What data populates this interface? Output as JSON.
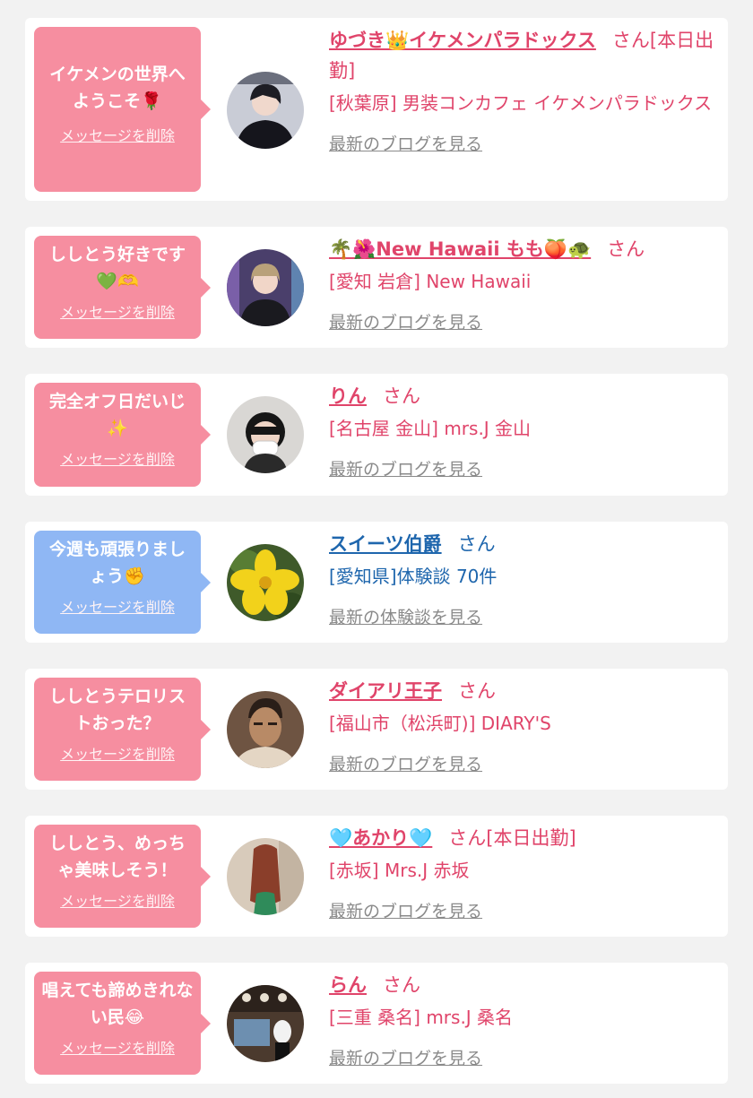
{
  "colors": {
    "bubble_pink": "#f68ea0",
    "bubble_blue": "#8fb7f4",
    "name_pink": "#e0446a",
    "name_blue": "#1e66ad",
    "link_gray": "#8a8a8a"
  },
  "messages": [
    {
      "bubble_text": "イケメンの世界へようこそ🌹",
      "delete_label": "メッセージを削除",
      "name": "ゆづき👑イケメンパラドックス",
      "suffix": "さん[本日出勤]",
      "shop": "[秋葉原] 男装コンカフェ イケメンパラドックス",
      "link": "最新のブログを見る",
      "type": "cast"
    },
    {
      "bubble_text": "ししとう好きです\n💚🫶",
      "delete_label": "メッセージを削除",
      "name": "🌴🌺New Hawaii もも🍑🐢",
      "suffix": "さん",
      "shop": "[愛知 岩倉] New Hawaii",
      "link": "最新のブログを見る",
      "type": "cast"
    },
    {
      "bubble_text": "完全オフ日だいじ\n✨",
      "delete_label": "メッセージを削除",
      "name": "りん",
      "suffix": "さん",
      "shop": "[名古屋 金山] mrs.J 金山",
      "link": "最新のブログを見る",
      "type": "cast"
    },
    {
      "bubble_text": "今週も頑張りましょう✊",
      "delete_label": "メッセージを削除",
      "name": "スイーツ伯爵",
      "suffix": "さん",
      "shop": "[愛知県]体験談 70件",
      "link": "最新の体験談を見る",
      "type": "user"
    },
    {
      "bubble_text": "ししとうテロリストおった？",
      "delete_label": "メッセージを削除",
      "name": "ダイアリ王子",
      "suffix": "さん",
      "shop": "[福山市（松浜町)] DIARY'S",
      "link": "最新のブログを見る",
      "type": "cast"
    },
    {
      "bubble_text": "ししとう、めっちゃ美味しそう！",
      "delete_label": "メッセージを削除",
      "name": "🩵あかり🩵",
      "suffix": "さん[本日出勤]",
      "shop": "[赤坂] Mrs.J 赤坂",
      "link": "最新のブログを見る",
      "type": "cast"
    },
    {
      "bubble_text": "唱えても諦めきれない民😂",
      "delete_label": "メッセージを削除",
      "name": "らん",
      "suffix": "さん",
      "shop": "[三重 桑名] mrs.J 桑名",
      "link": "最新のブログを見る",
      "type": "cast"
    }
  ]
}
